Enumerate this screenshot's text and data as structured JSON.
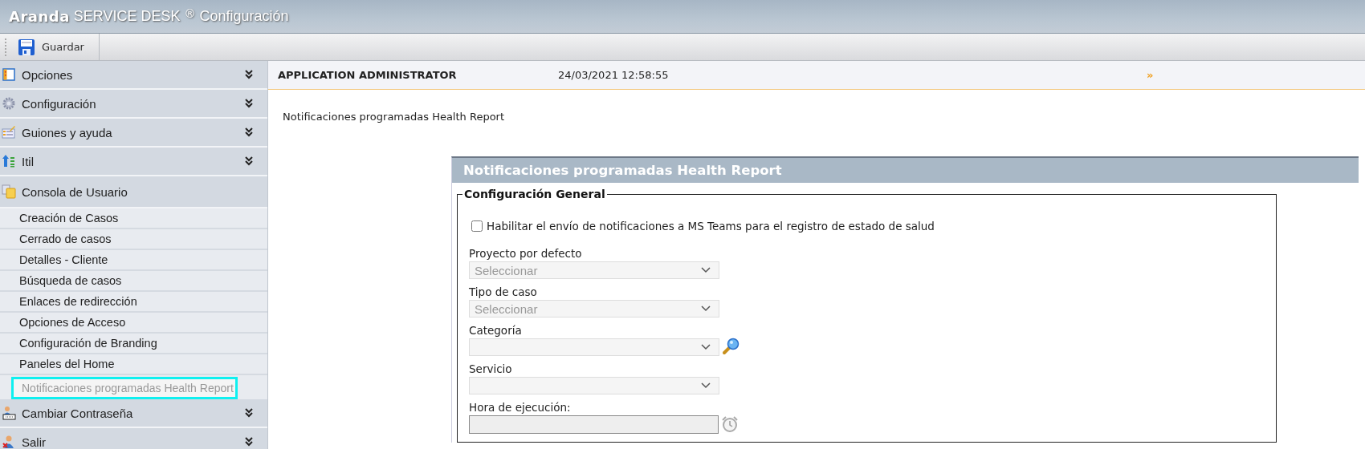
{
  "header": {
    "brand": "Aranda",
    "product": "SERVICE DESK",
    "mark": "®",
    "title": "Configuración"
  },
  "toolbar": {
    "buttons": [
      "Guardar"
    ]
  },
  "sidebar": {
    "sections": [
      {
        "label": "Opciones",
        "expanded": false
      },
      {
        "label": "Configuración",
        "expanded": false
      },
      {
        "label": "Guiones y ayuda",
        "expanded": false
      },
      {
        "label": "Itil",
        "expanded": false
      },
      {
        "label": "Consola de Usuario",
        "expanded": true,
        "children": [
          {
            "label": "Creación de Casos",
            "selected": false
          },
          {
            "label": "Cerrado de casos",
            "selected": false
          },
          {
            "label": "Detalles - Cliente",
            "selected": false
          },
          {
            "label": "Búsqueda de casos",
            "selected": false
          },
          {
            "label": "Enlaces de redirección",
            "selected": false
          },
          {
            "label": "Opciones de Acceso",
            "selected": false
          },
          {
            "label": "Configuración de Branding",
            "selected": false
          },
          {
            "label": "Paneles del Home",
            "selected": false
          },
          {
            "label": "Notificaciones programadas Health Report",
            "selected": true
          }
        ]
      },
      {
        "label": "Cambiar Contraseña",
        "expanded": false
      },
      {
        "label": "Salir",
        "expanded": false
      }
    ]
  },
  "info_bar": {
    "user": "APPLICATION ADMINISTRATOR",
    "datetime": "24/03/2021 12:58:55",
    "more": "»"
  },
  "page_title": "Notificaciones programadas Health Report",
  "panel": {
    "title": "Notificaciones programadas Health Report",
    "fieldset": "Configuración General",
    "checkbox": {
      "label": "Habilitar el envío de notificaciones a MS Teams para el registro de estado de salud",
      "checked": false
    },
    "fields": [
      {
        "label": "Proyecto por defecto",
        "kind": "select",
        "value": "Seleccionar"
      },
      {
        "label": "Tipo de caso",
        "kind": "select",
        "value": "Seleccionar"
      },
      {
        "label": "Categoría",
        "kind": "search-select"
      },
      {
        "label": "Servicio",
        "kind": "select"
      },
      {
        "label": "Hora de ejecución:",
        "kind": "time"
      }
    ]
  }
}
